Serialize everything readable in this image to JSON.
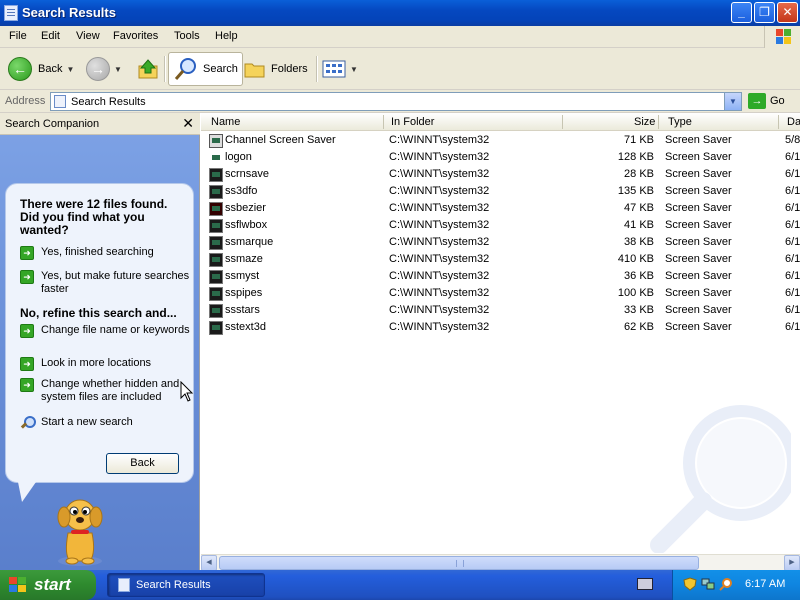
{
  "window": {
    "title": "Search Results"
  },
  "menu": [
    "File",
    "Edit",
    "View",
    "Favorites",
    "Tools",
    "Help"
  ],
  "toolbar": {
    "back": "Back",
    "search": "Search",
    "folders": "Folders"
  },
  "address": {
    "label": "Address",
    "value": "Search Results",
    "go": "Go"
  },
  "companion": {
    "title": "Search Companion",
    "close": "✕",
    "question": "There were 12 files found. Did you find what you wanted?",
    "opt1": "Yes, finished searching",
    "opt2": "Yes, but make future searches faster",
    "refine": "No, refine this search and...",
    "ref1": "Change file name or keywords",
    "ref2": "Look in more locations",
    "ref3": "Change whether hidden and system files are included",
    "newsearch": "Start a new search",
    "back": "Back"
  },
  "columns": {
    "name": "Name",
    "folder": "In Folder",
    "size": "Size",
    "type": "Type",
    "date": "Da"
  },
  "files": [
    {
      "name": "Channel Screen Saver",
      "folder": "C:\\WINNT\\system32",
      "size": "71 KB",
      "type": "Screen Saver",
      "date": "5/8"
    },
    {
      "name": "logon",
      "folder": "C:\\WINNT\\system32",
      "size": "128 KB",
      "type": "Screen Saver",
      "date": "6/1"
    },
    {
      "name": "scrnsave",
      "folder": "C:\\WINNT\\system32",
      "size": "28 KB",
      "type": "Screen Saver",
      "date": "6/1"
    },
    {
      "name": "ss3dfo",
      "folder": "C:\\WINNT\\system32",
      "size": "135 KB",
      "type": "Screen Saver",
      "date": "6/1"
    },
    {
      "name": "ssbezier",
      "folder": "C:\\WINNT\\system32",
      "size": "47 KB",
      "type": "Screen Saver",
      "date": "6/1"
    },
    {
      "name": "ssflwbox",
      "folder": "C:\\WINNT\\system32",
      "size": "41 KB",
      "type": "Screen Saver",
      "date": "6/1"
    },
    {
      "name": "ssmarque",
      "folder": "C:\\WINNT\\system32",
      "size": "38 KB",
      "type": "Screen Saver",
      "date": "6/1"
    },
    {
      "name": "ssmaze",
      "folder": "C:\\WINNT\\system32",
      "size": "410 KB",
      "type": "Screen Saver",
      "date": "6/1"
    },
    {
      "name": "ssmyst",
      "folder": "C:\\WINNT\\system32",
      "size": "36 KB",
      "type": "Screen Saver",
      "date": "6/1"
    },
    {
      "name": "sspipes",
      "folder": "C:\\WINNT\\system32",
      "size": "100 KB",
      "type": "Screen Saver",
      "date": "6/1"
    },
    {
      "name": "ssstars",
      "folder": "C:\\WINNT\\system32",
      "size": "33 KB",
      "type": "Screen Saver",
      "date": "6/1"
    },
    {
      "name": "sstext3d",
      "folder": "C:\\WINNT\\system32",
      "size": "62 KB",
      "type": "Screen Saver",
      "date": "6/1"
    }
  ],
  "taskbar": {
    "start": "start",
    "task": "Search Results",
    "clock": "6:17 AM"
  },
  "colors": {
    "titlebar": "#0548c0",
    "taskbar": "#245edc",
    "start": "#2e8a2e",
    "panel": "#6a8fd8"
  }
}
